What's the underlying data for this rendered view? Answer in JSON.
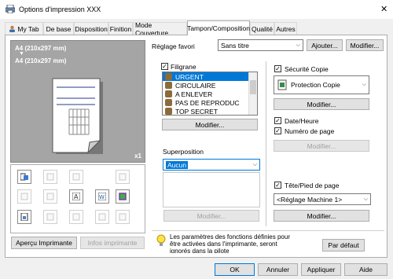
{
  "window": {
    "title": "Options d'impression XXX",
    "close_glyph": "✕"
  },
  "tabs": [
    "My Tab",
    "De base",
    "Disposition",
    "Finition",
    "Mode Couverture",
    "Tampon/Composition",
    "Qualité",
    "Autres"
  ],
  "favorite": {
    "label": "Réglage favori",
    "value": "Sans titre",
    "add_button": "Ajouter...",
    "modify_button": "Modifier..."
  },
  "preview": {
    "paper_top": "A4 (210x297 mm)",
    "paper_bottom": "A4 (210x297 mm)",
    "arrow": "▼",
    "copies": "x1"
  },
  "left_buttons": {
    "printer_view": "Aperçu Imprimante",
    "printer_info": "Infos imprimante"
  },
  "watermark": {
    "label": "Filigrane",
    "checked": true,
    "items": [
      "URGENT",
      "CIRCULAIRE",
      "A ENLEVER",
      "PAS DE REPRODUC",
      "TOP SECRET"
    ],
    "selected_index": 0,
    "modify_button": "Modifier..."
  },
  "overlay": {
    "label": "Superposition",
    "value": "Aucun",
    "modify_button": "Modifier..."
  },
  "copy_security": {
    "label": "Sécurité Copie",
    "checked": true,
    "value": "Protection Copie",
    "modify_button": "Modifier..."
  },
  "date_time": {
    "label": "Date/Heure",
    "checked": true
  },
  "page_number": {
    "label": "Numéro de page",
    "checked": true,
    "modify_button": "Modifier..."
  },
  "header_footer": {
    "label": "Tête/Pied de page",
    "checked": true,
    "value": "<Réglage Machine 1>",
    "modify_button": "Modifier..."
  },
  "info": {
    "text": "Les paramètres des fonctions définies pour être activées dans l'imprimante, seront ignorés dans la pilote",
    "default_button": "Par défaut"
  },
  "footer": {
    "ok": "OK",
    "cancel": "Annuler",
    "apply": "Appliquer",
    "help": "Aide"
  }
}
